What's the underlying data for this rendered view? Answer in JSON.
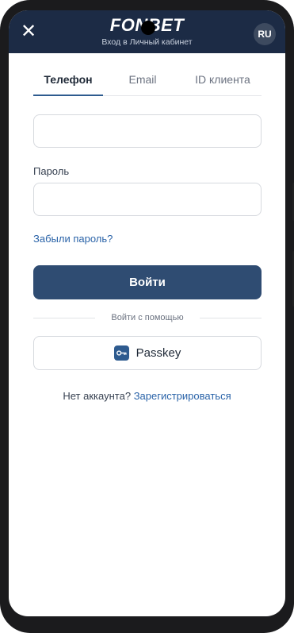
{
  "header": {
    "close_icon": "close-icon",
    "logo_text": "FONBET",
    "subtitle": "Вход в Личный кабинет",
    "lang_label": "RU"
  },
  "tabs": [
    {
      "label": "Телефон",
      "active": true
    },
    {
      "label": "Email",
      "active": false
    },
    {
      "label": "ID клиента",
      "active": false
    }
  ],
  "form": {
    "phone_value": "",
    "password_label": "Пароль",
    "password_value": "",
    "forgot_label": "Забыли пароль?",
    "login_label": "Войти",
    "divider_label": "Войти с помощью",
    "passkey_label": "Passkey",
    "passkey_icon": "key-icon"
  },
  "signup": {
    "prompt": "Нет аккаунта?",
    "link": "Зарегистрироваться"
  },
  "colors": {
    "header_bg": "#1c2b45",
    "primary_button": "#2f4c72",
    "link": "#2a63a8",
    "tab_underline": "#2e5b8f"
  }
}
